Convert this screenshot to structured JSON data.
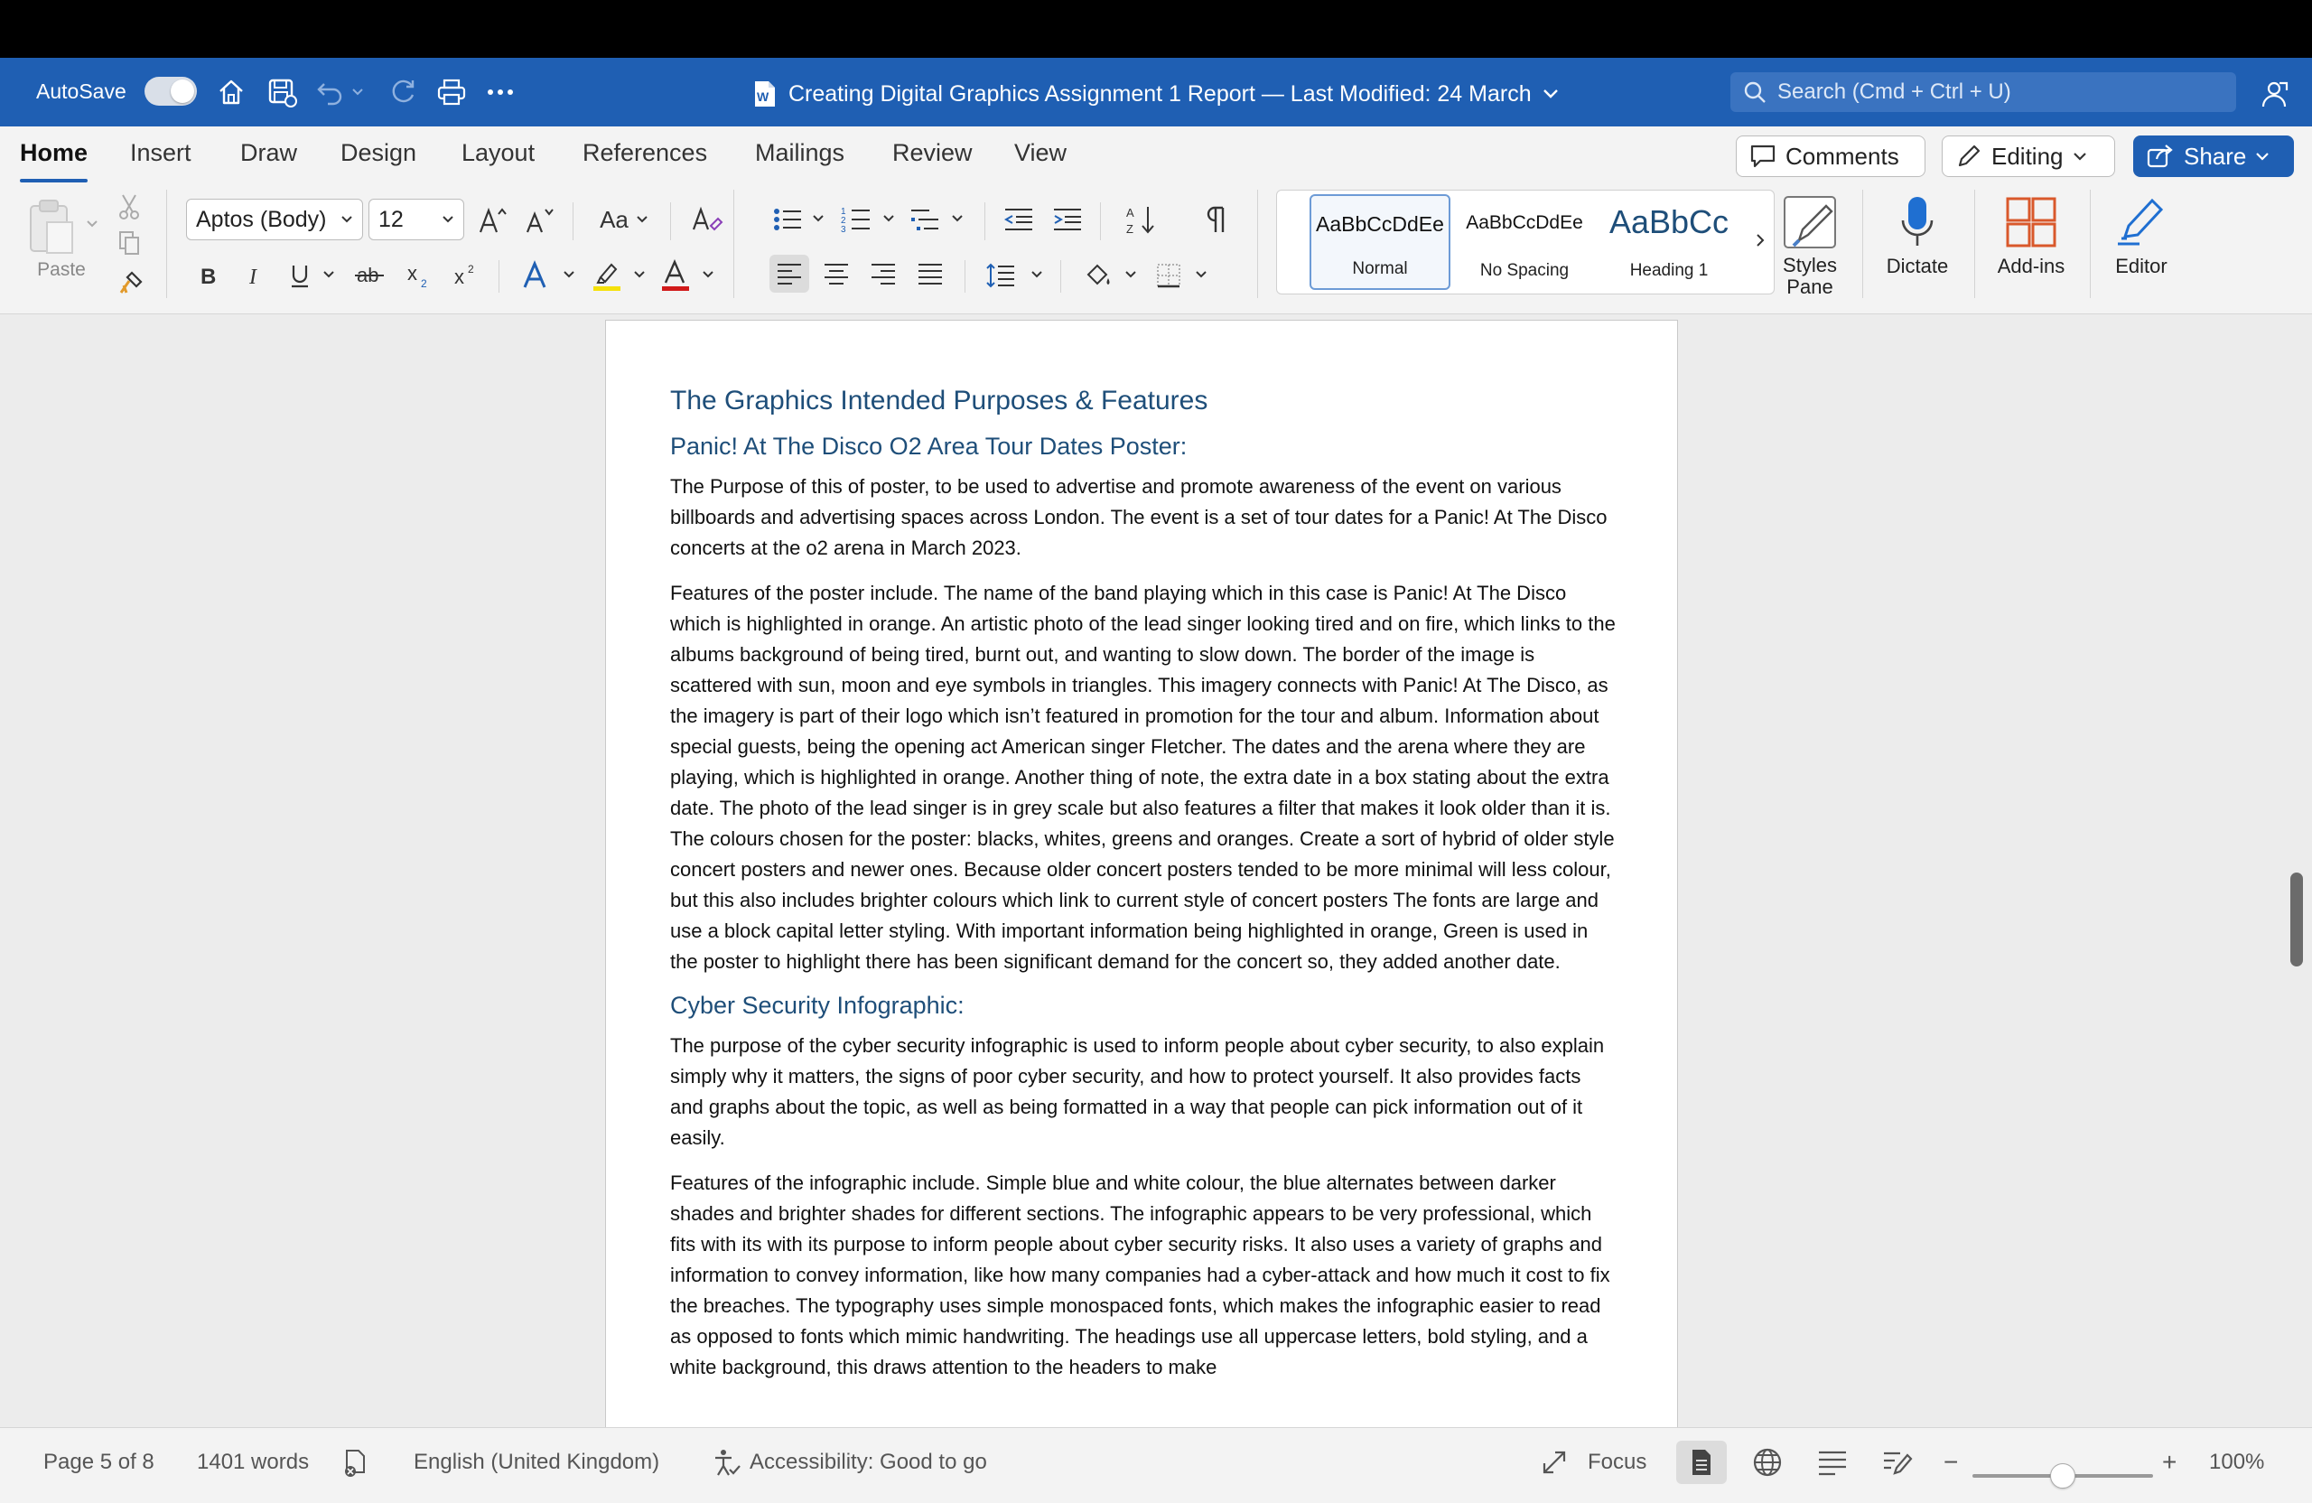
{
  "window": {
    "autosave_label": "AutoSave",
    "autosave_state": "on",
    "doc_title": "Creating Digital Graphics Assignment 1 Report — Last Modified: 24 March",
    "search_placeholder": "Search (Cmd + Ctrl + U)"
  },
  "tabs": [
    "Home",
    "Insert",
    "Draw",
    "Design",
    "Layout",
    "References",
    "Mailings",
    "Review",
    "View"
  ],
  "active_tab": "Home",
  "header_buttons": {
    "comments": "Comments",
    "editing": "Editing",
    "share": "Share"
  },
  "ribbon": {
    "paste_label": "Paste",
    "font_name": "Aptos (Body)",
    "font_size": "12",
    "change_case": "Aa",
    "styles": [
      {
        "preview": "AaBbCcDdEe",
        "name": "Normal"
      },
      {
        "preview": "AaBbCcDdEe",
        "name": "No Spacing"
      },
      {
        "preview": "AaBbCc",
        "name": "Heading 1"
      }
    ],
    "styles_pane": "Styles Pane",
    "dictate": "Dictate",
    "addins": "Add-ins",
    "editor": "Editor"
  },
  "document": {
    "heading1": "The Graphics Intended Purposes & Features",
    "section1_title": "Panic! At The Disco O2 Area Tour Dates Poster:",
    "section1_p1": "The Purpose of this of poster, to be used to advertise and promote awareness of the event on various billboards and advertising spaces across London. The event is a set of tour dates for a Panic! At The Disco concerts at the o2 arena in March 2023.",
    "section1_p2": "Features of the poster include. The name of the band playing which in this case is Panic! At The Disco which is highlighted in orange. An artistic photo of the lead singer looking tired and on fire, which links to the albums background of being tired, burnt out, and wanting to slow down. The border of the image is scattered with sun, moon and eye symbols in triangles. This imagery connects with Panic! At The Disco, as the imagery is part of their logo which isn’t featured in promotion for the tour and album. Information about special guests, being the opening act American singer Fletcher. The dates and the arena where they are playing, which is highlighted in orange. Another thing of note, the extra date in a box stating about the extra date. The photo of the lead singer is in grey scale but also features a filter that makes it look older than it is. The colours chosen for the poster: blacks, whites, greens and oranges. Create a sort of hybrid of older style concert posters and newer ones. Because older concert posters tended to be more minimal will less colour, but this also includes brighter colours which link to current style of concert posters The fonts are large and use a block capital letter styling. With important information being highlighted in orange, Green is used in the poster to highlight there has been significant demand for the concert so, they added another date.",
    "section2_title": "Cyber Security Infographic:",
    "section2_p1": "The purpose of the cyber security infographic is used to inform people about cyber security, to also explain simply why it matters, the signs of poor cyber security, and how to protect yourself. It also provides facts and graphs about the topic, as well as being formatted in a way that people can pick information out of it easily.",
    "section2_p2": "Features of the infographic include. Simple blue and white colour, the blue alternates between darker shades and brighter shades for different sections. The infographic appears to be very professional, which fits with its with its purpose to inform people about cyber security risks. It also uses a variety of graphs and information to convey information, like how many companies had a cyber-attack and how much it cost to fix the breaches. The typography uses simple monospaced fonts, which makes the infographic easier to read as opposed to fonts which mimic handwriting. The headings use all uppercase letters, bold styling, and a white background, this draws attention to the headers to make"
  },
  "status": {
    "page": "Page 5 of 8",
    "words": "1401 words",
    "language": "English (United Kingdom)",
    "accessibility": "Accessibility: Good to go",
    "focus": "Focus",
    "zoom_minus": "−",
    "zoom_plus": "+",
    "zoom": "100%"
  },
  "colors": {
    "title_bar": "#1f5fb3",
    "heading_text": "#1e4e79",
    "highlight_yellow": "#f5e10a",
    "font_color_red": "#d11a1a",
    "addins_orange": "#d9582b"
  }
}
